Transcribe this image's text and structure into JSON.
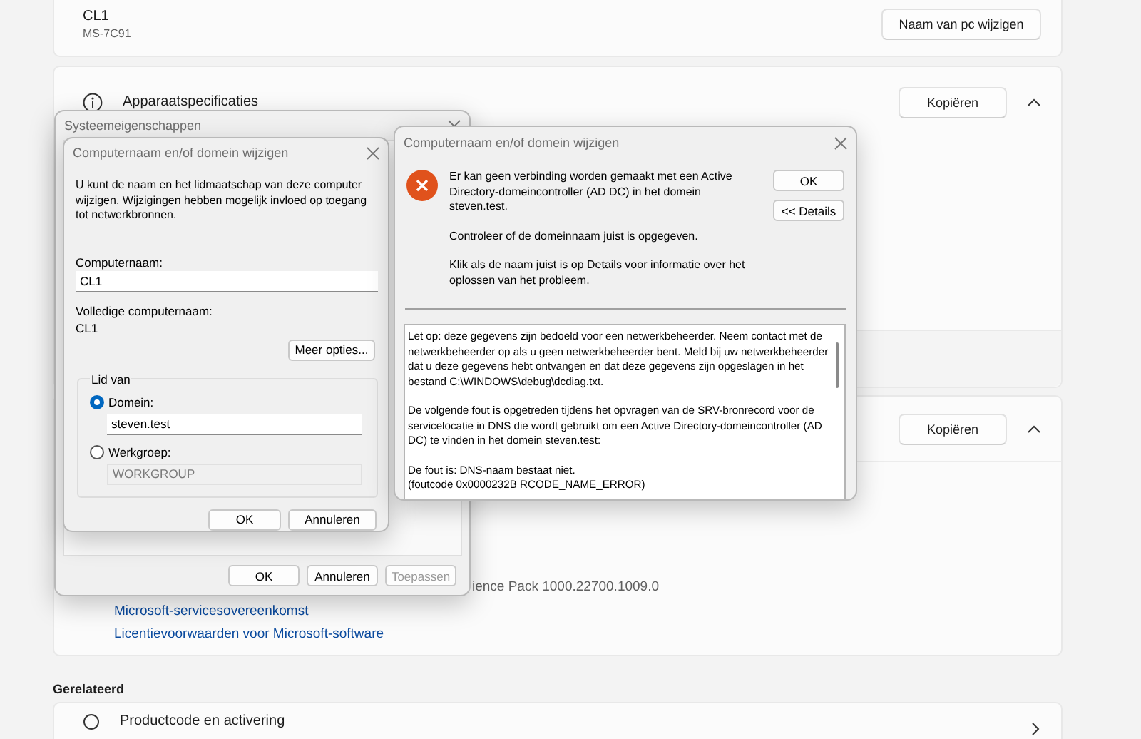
{
  "settings": {
    "device": {
      "name": "CL1",
      "model": "MS-7C91",
      "rename_button": "Naam van pc wijzigen"
    },
    "specs_card": {
      "title": "Apparaatspecificaties",
      "copy_button": "Kopiëren",
      "expanded": true
    },
    "windows_card": {
      "copy_button": "Kopiëren",
      "expanded": true,
      "version_fragment": "ience Pack 1000.22700.1009.0",
      "links": [
        "Microsoft-servicesovereenkomst",
        "Licentievoorwaarden voor Microsoft-software"
      ]
    },
    "related": {
      "heading": "Gerelateerd",
      "items": [
        {
          "label": "Productcode en activering"
        }
      ]
    }
  },
  "system_properties": {
    "title": "Systeemeigenschappen",
    "buttons": [
      {
        "label": "OK",
        "disabled": false
      },
      {
        "label": "Annuleren",
        "disabled": false
      },
      {
        "label": "Toepassen",
        "disabled": true
      }
    ]
  },
  "rename_dialog": {
    "title": "Computernaam en/of domein wijzigen",
    "description": "U kunt de naam en het lidmaatschap van deze computer wijzigen. Wijzigingen hebben mogelijk invloed op toegang tot netwerkbronnen.",
    "name_label": "Computernaam:",
    "name_value": "CL1",
    "full_name_label": "Volledige computernaam:",
    "full_name": "CL1",
    "more_button": "Meer opties...",
    "member_group": "Lid van",
    "member_options": [
      {
        "label": "Domein:",
        "value": "steven.test",
        "selected": true
      },
      {
        "label": "Werkgroep:",
        "value": "WORKGROUP",
        "selected": false
      }
    ],
    "buttons": [
      "OK",
      "Annuleren"
    ]
  },
  "error_dialog": {
    "title": "Computernaam en/of domein wijzigen",
    "messages": [
      "Er kan geen verbinding worden gemaakt met een Active Directory-domeincontroller (AD DC) in het domein steven.test.",
      "Controleer of de domeinnaam juist is opgegeven.",
      "Klik als de naam juist is op Details voor informatie over het oplossen van het probleem."
    ],
    "buttons": [
      "OK",
      "<< Details"
    ],
    "details": [
      "Let op: deze gegevens zijn bedoeld voor een netwerkbeheerder. Neem contact met de netwerkbeheerder op als u geen netwerkbeheerder bent. Meld bij uw netwerkbeheerder dat u deze gegevens hebt ontvangen en dat deze gegevens zijn opgeslagen in het bestand C:\\WINDOWS\\debug\\dcdiag.txt.",
      "De volgende fout is opgetreden tijdens het opvragen van de SRV-bronrecord voor de servicelocatie in DNS die wordt gebruikt om een Active Directory-domeincontroller (AD DC) te vinden in het domein steven.test:",
      "De fout is: DNS-naam bestaat niet.\n(foutcode 0x0000232B RCODE_NAME_ERROR)"
    ]
  }
}
